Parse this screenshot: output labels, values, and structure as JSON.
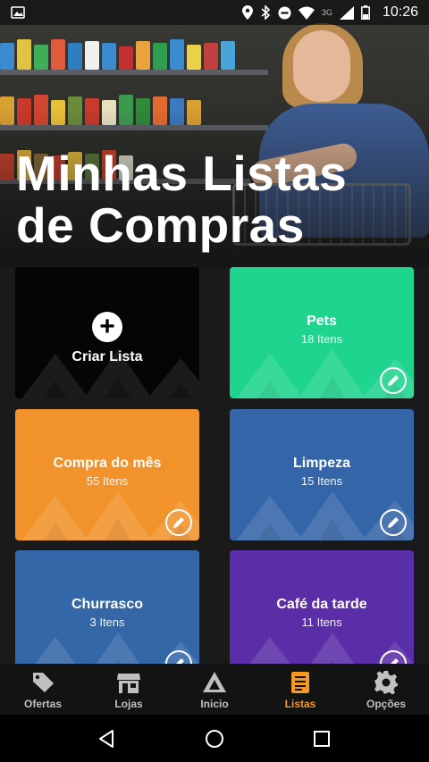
{
  "statusbar": {
    "time": "10:26",
    "network": "3G"
  },
  "header": {
    "title_line1": "Minhas Listas",
    "title_line2": "de Compras"
  },
  "create_card": {
    "label": "Criar Lista"
  },
  "lists": [
    {
      "name": "Pets",
      "count": "18 Itens",
      "color": "#1ed48f"
    },
    {
      "name": "Compra do mês",
      "count": "55 Itens",
      "color": "#f2922a"
    },
    {
      "name": "Limpeza",
      "count": "15 Itens",
      "color": "#3465a8"
    },
    {
      "name": "Churrasco",
      "count": "3 Itens",
      "color": "#3467a8"
    },
    {
      "name": "Café da tarde",
      "count": "11 Itens",
      "color": "#5a2ea6"
    }
  ],
  "nav": {
    "items": [
      {
        "label": "Ofertas",
        "icon": "tag-icon"
      },
      {
        "label": "Lojas",
        "icon": "store-icon"
      },
      {
        "label": "Inicio",
        "icon": "home-triangle-icon"
      },
      {
        "label": "Listas",
        "icon": "list-icon"
      },
      {
        "label": "Opções",
        "icon": "gear-icon"
      }
    ],
    "active_color": "#f59a23"
  }
}
